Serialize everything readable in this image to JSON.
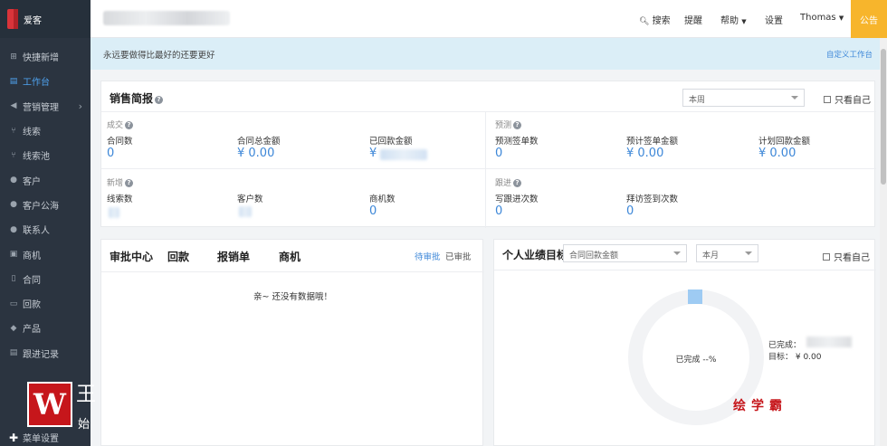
{
  "app": {
    "logo_text": "爱客"
  },
  "sidebar": {
    "items": [
      {
        "label": "快捷新增",
        "icon": "plus-square-icon"
      },
      {
        "label": "工作台",
        "icon": "dashboard-icon",
        "active": true
      },
      {
        "label": "营销管理",
        "icon": "megaphone-icon",
        "has_arrow": true
      },
      {
        "label": "线索",
        "icon": "branch-icon"
      },
      {
        "label": "线索池",
        "icon": "branch-pool-icon"
      },
      {
        "label": "客户",
        "icon": "person-icon"
      },
      {
        "label": "客户公海",
        "icon": "people-icon"
      },
      {
        "label": "联系人",
        "icon": "contact-icon"
      },
      {
        "label": "商机",
        "icon": "opportunity-icon"
      },
      {
        "label": "合同",
        "icon": "document-icon"
      },
      {
        "label": "回款",
        "icon": "money-icon"
      },
      {
        "label": "产品",
        "icon": "box-icon"
      },
      {
        "label": "跟进记录",
        "icon": "record-icon"
      }
    ],
    "footer_label": "菜单设置"
  },
  "topbar": {
    "search": "搜索",
    "remind": "提醒",
    "help": "帮助",
    "settings": "设置",
    "user": "Thomas",
    "notice": "公告"
  },
  "banner": {
    "text": "永远要做得比最好的还要更好",
    "link": "自定义工作台"
  },
  "sales": {
    "title": "销售简报",
    "period_select": "本周",
    "only_me": "只看自己",
    "deal": {
      "label": "成交",
      "metrics": [
        {
          "label": "合同数",
          "value": "0"
        },
        {
          "label": "合同总金额",
          "value": "¥ 0.00"
        },
        {
          "label": "已回款金额",
          "value": "¥"
        }
      ]
    },
    "forecast": {
      "label": "预测",
      "metrics": [
        {
          "label": "预测签单数",
          "value": "0"
        },
        {
          "label": "预计签单金额",
          "value": "¥ 0.00"
        },
        {
          "label": "计划回款金额",
          "value": "¥ 0.00"
        }
      ]
    },
    "new": {
      "label": "新增",
      "metrics": [
        {
          "label": "线索数",
          "value": ""
        },
        {
          "label": "客户数",
          "value": ""
        },
        {
          "label": "商机数",
          "value": "0"
        }
      ]
    },
    "followup": {
      "label": "跟进",
      "metrics": [
        {
          "label": "写跟进次数",
          "value": "0"
        },
        {
          "label": "拜访签到次数",
          "value": "0"
        }
      ]
    }
  },
  "approval": {
    "tabs": [
      "审批中心",
      "回款",
      "报销单",
      "商机"
    ],
    "pending": "待审批",
    "approved": "已审批",
    "empty": "亲~ 还没有数据哦！"
  },
  "goal": {
    "title": "个人业绩目标",
    "metric_select": "合同回款金额",
    "month_select": "本月",
    "only_me": "只看自己",
    "ring_label": "已完成 --%",
    "done_label": "已完成：",
    "target_label": "目标： ¥ 0.00",
    "progress": 0
  },
  "watermark": {
    "letter": "W",
    "line1": "王",
    "line2": "始",
    "brand": "绘学霸"
  },
  "colors": {
    "accent": "#3d87d8",
    "sidebar_bg": "#2b3440",
    "notice_bg": "#f7b52c",
    "banner_bg": "#dbeef7"
  }
}
